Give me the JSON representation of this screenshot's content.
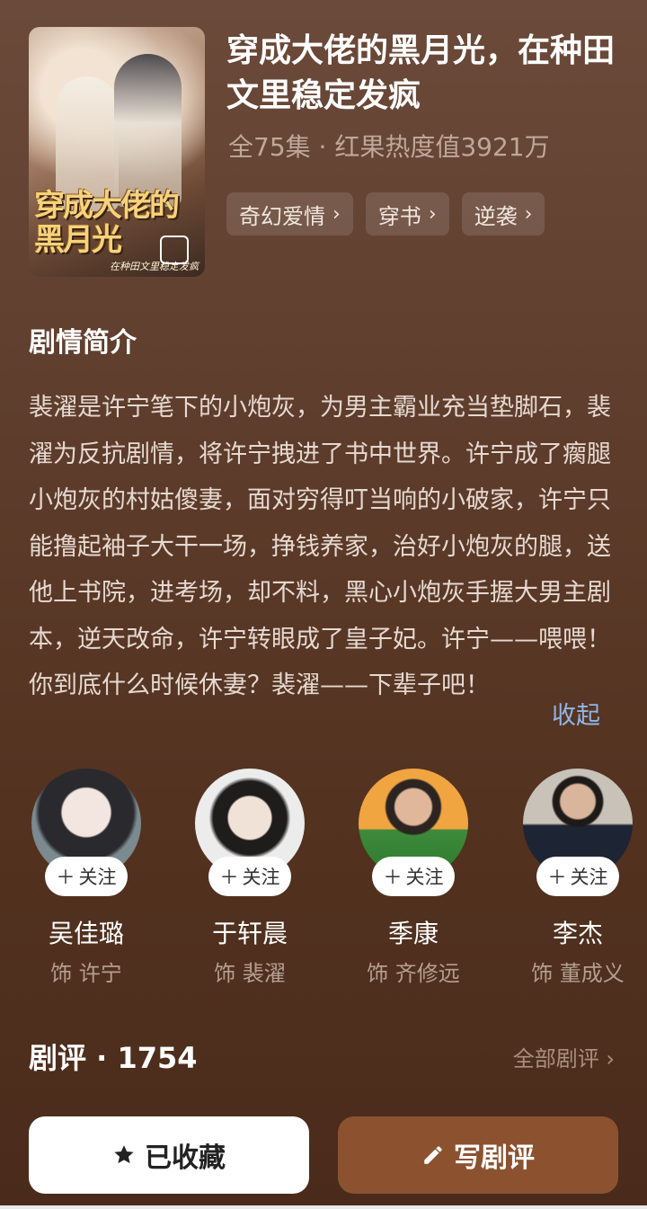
{
  "drama": {
    "title": "穿成大佬的黑月光，在种田文里稳定发疯",
    "meta": "全75集 · 红果热度值3921万",
    "tags": [
      "奇幻爱情",
      "穿书",
      "逆袭"
    ],
    "poster_title": "穿成大佬的黑月光",
    "poster_sub": "在种田文里稳定发疯"
  },
  "synopsis": {
    "heading": "剧情简介",
    "text": "裴濯是许宁笔下的小炮灰，为男主霸业充当垫脚石，裴濯为反抗剧情，将许宁拽进了书中世界。许宁成了瘸腿小炮灰的村姑傻妻，面对穷得叮当响的小破家，许宁只能撸起袖子大干一场，挣钱养家，治好小炮灰的腿，送他上书院，进考场，却不料，黑心小炮灰手握大男主剧本，逆天改命，许宁转眼成了皇子妃。许宁——喂喂！你到底什么时候休妻？裴濯——下辈子吧！",
    "collapse_label": "收起"
  },
  "cast": [
    {
      "name": "吴佳璐",
      "role": "饰 许宁",
      "follow": "关注"
    },
    {
      "name": "于轩晨",
      "role": "饰 裴濯",
      "follow": "关注"
    },
    {
      "name": "季康",
      "role": "饰 齐修远",
      "follow": "关注"
    },
    {
      "name": "李杰",
      "role": "饰 董成义",
      "follow": "关注"
    }
  ],
  "reviews": {
    "heading": "剧评 · 1754",
    "all_label": "全部剧评"
  },
  "actions": {
    "favorite_label": "已收藏",
    "write_label": "写剧评"
  },
  "colors": {
    "accent_link": "#8fb6e6",
    "write_button": "#8c5230"
  }
}
